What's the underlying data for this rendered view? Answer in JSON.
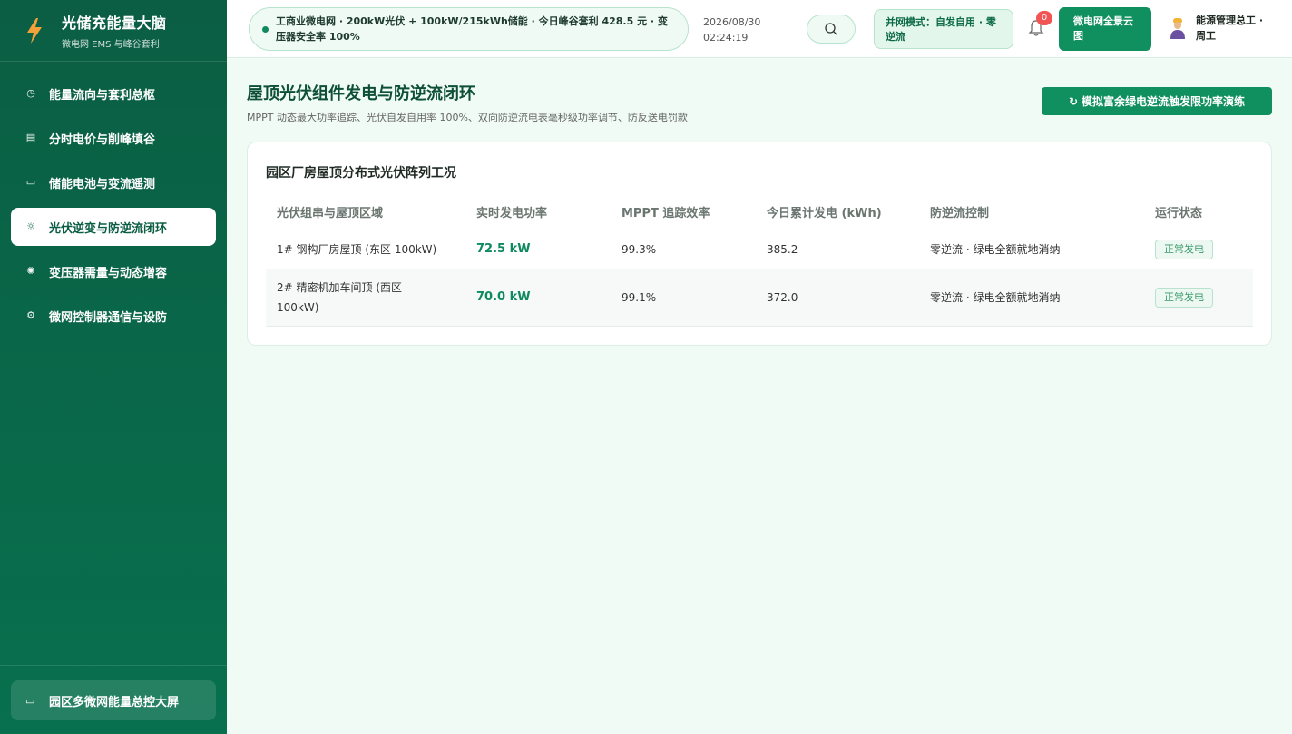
{
  "brand": {
    "title": "光储充能量大脑",
    "subtitle": "微电网 EMS 与峰谷套利"
  },
  "sidebar": {
    "items": [
      {
        "label": "能量流向与套利总枢",
        "icon": "dashboard-icon"
      },
      {
        "label": "分时电价与削峰填谷",
        "icon": "chart-icon"
      },
      {
        "label": "储能电池与变流遥测",
        "icon": "battery-icon"
      },
      {
        "label": "光伏逆变与防逆流闭环",
        "icon": "sun-icon",
        "active": true
      },
      {
        "label": "变压器需量与动态增容",
        "icon": "transformer-icon"
      },
      {
        "label": "微网控制器通信与设防",
        "icon": "settings-icon"
      }
    ],
    "bottom_button": "园区多微网能量总控大屏"
  },
  "header": {
    "ticker": "工商业微电网 · 200kW光伏 + 100kW/215kWh储能 · 今日峰谷套利 428.5 元 · 变压器安全率 100%",
    "date": "2026/08/30",
    "time": "02:24:19",
    "mode": "并网模式：自发自用 · 零逆流",
    "notifications": "0",
    "cloud_button": "微电网全景云图",
    "user": "能源管理总工 · 周工"
  },
  "main": {
    "title": "屋顶光伏组件发电与防逆流闭环",
    "subtitle": "MPPT 动态最大功率追踪、光伏自发自用率 100%、双向防逆流电表毫秒级功率调节、防反送电罚款",
    "sim_button": "模拟富余绿电逆流触发限功率演练",
    "card_title": "园区厂房屋顶分布式光伏阵列工况",
    "table": {
      "headers": [
        "光伏组串与屋顶区域",
        "实时发电功率",
        "MPPT 追踪效率",
        "今日累计发电 (kWh)",
        "防逆流控制",
        "运行状态"
      ],
      "rows": [
        [
          "1# 钢构厂房屋顶 (东区 100kW)",
          "72.5 kW",
          "99.3%",
          "385.2",
          "零逆流 · 绿电全额就地消纳",
          "正常发电"
        ],
        [
          "2# 精密机加车间顶 (西区 100kW)",
          "70.0 kW",
          "99.1%",
          "372.0",
          "零逆流 · 绿电全额就地消纳",
          "正常发电"
        ]
      ]
    }
  },
  "colors": {
    "primary": "#11905f",
    "sidebar": "#0b5e43",
    "alert": "#f05454"
  }
}
